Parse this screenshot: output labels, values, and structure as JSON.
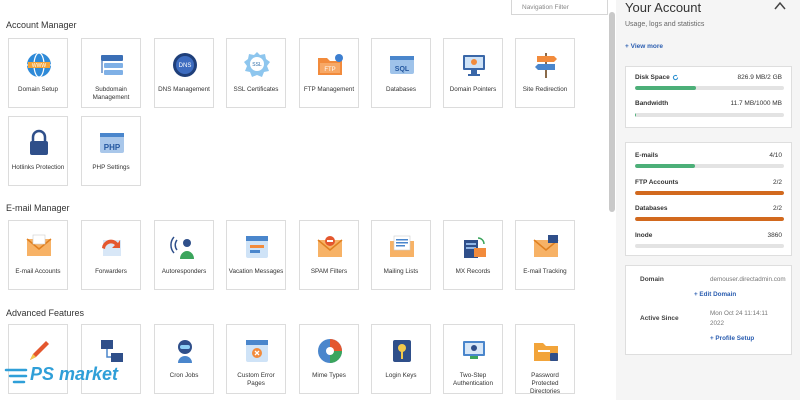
{
  "nav_filter": {
    "placeholder": "Navigation Filter"
  },
  "sections": [
    {
      "title": "Account Manager",
      "items": [
        {
          "label": "Domain Setup",
          "icon": "globe-icon"
        },
        {
          "label": "Subdomain Management",
          "icon": "subdomain-icon"
        },
        {
          "label": "DNS Management",
          "icon": "dns-icon"
        },
        {
          "label": "SSL Certificates",
          "icon": "ssl-badge-icon"
        },
        {
          "label": "FTP Management",
          "icon": "ftp-folder-icon"
        },
        {
          "label": "Databases",
          "icon": "sql-icon"
        },
        {
          "label": "Domain Pointers",
          "icon": "monitor-icon"
        },
        {
          "label": "Site Redirection",
          "icon": "signpost-icon"
        },
        {
          "label": "Hotlinks Protection",
          "icon": "lock-icon"
        },
        {
          "label": "PHP Settings",
          "icon": "php-icon"
        }
      ]
    },
    {
      "title": "E-mail Manager",
      "items": [
        {
          "label": "E-mail Accounts",
          "icon": "envelope-icon"
        },
        {
          "label": "Forwarders",
          "icon": "forward-icon"
        },
        {
          "label": "Autoresponders",
          "icon": "autoresponder-icon"
        },
        {
          "label": "Vacation Messages",
          "icon": "vacation-icon"
        },
        {
          "label": "SPAM Filters",
          "icon": "spam-filter-icon"
        },
        {
          "label": "Mailing Lists",
          "icon": "mailing-list-icon"
        },
        {
          "label": "MX Records",
          "icon": "mx-records-icon"
        },
        {
          "label": "E-mail Tracking",
          "icon": "email-tracking-icon"
        }
      ]
    },
    {
      "title": "Advanced Features",
      "items": [
        {
          "label": "",
          "icon": "pencil-icon"
        },
        {
          "label": "",
          "icon": "network-icon"
        },
        {
          "label": "Cron Jobs",
          "icon": "robot-icon"
        },
        {
          "label": "Custom Error Pages",
          "icon": "error-page-icon"
        },
        {
          "label": "Mime Types",
          "icon": "mime-types-icon"
        },
        {
          "label": "Login Keys",
          "icon": "keys-icon"
        },
        {
          "label": "Two-Step Authentication",
          "icon": "two-step-icon"
        },
        {
          "label": "Password Protected Directories",
          "icon": "protected-folder-icon"
        }
      ]
    }
  ],
  "account": {
    "title": "Your Account",
    "subtitle": "Usage, logs and statistics",
    "view_more": "+ View more",
    "usage1": [
      {
        "label": "Disk Space",
        "value": "826.9 MB/2 GB",
        "fill": 0.41,
        "color": "#4caf78"
      },
      {
        "label": "Bandwidth",
        "value": "11.7 MB/1000 MB",
        "fill": 0.01,
        "color": "#4caf78"
      }
    ],
    "usage2": [
      {
        "label": "E-mails",
        "value": "4/10",
        "fill": 0.4,
        "color": "#4caf78"
      },
      {
        "label": "FTP Accounts",
        "value": "2/2",
        "fill": 1.0,
        "color": "#d2691e"
      },
      {
        "label": "Databases",
        "value": "2/2",
        "fill": 1.0,
        "color": "#d2691e"
      },
      {
        "label": "Inode",
        "value": "3860",
        "fill": 0.0,
        "color": "#4caf78"
      }
    ],
    "domain_label": "Domain",
    "domain_value": "demouser.directadmin.com",
    "edit_domain": "+ Edit Domain",
    "active_label": "Active Since",
    "active_value_1": "Mon Oct 24 11:14:11",
    "active_value_2": "2022",
    "profile_setup": "+ Profile Setup"
  },
  "logo": {
    "text": "PS market"
  }
}
